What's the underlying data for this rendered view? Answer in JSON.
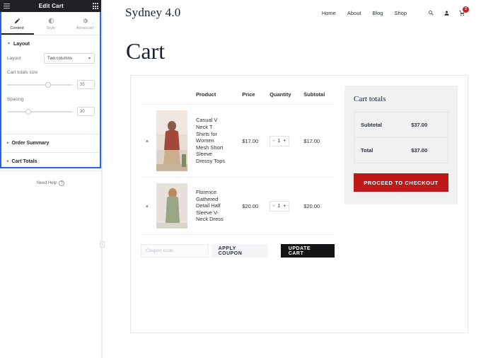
{
  "editor": {
    "topbar": {
      "title": "Edit Cart",
      "menu_icon": "hamburger-icon",
      "apps_icon": "grid-apps-icon"
    },
    "tabs": [
      {
        "label": "Content",
        "icon": "pencil-icon",
        "active": true
      },
      {
        "label": "Style",
        "icon": "contrast-icon",
        "active": false
      },
      {
        "label": "Advanced",
        "icon": "gear-icon",
        "active": false
      }
    ],
    "sections": {
      "layout": {
        "title": "Layout",
        "layout_label": "Layout",
        "layout_value": "Two columns",
        "cart_totals_size_label": "Cart totals size",
        "cart_totals_size_value": "35",
        "spacing_label": "Spacing",
        "spacing_value": "30"
      },
      "order_summary": {
        "title": "Order Summary"
      },
      "cart_totals": {
        "title": "Cart Totals"
      }
    },
    "need_help": {
      "label": "Need Help",
      "icon": "question-circle-icon"
    },
    "collapse_icon": "chevron-left-icon"
  },
  "site": {
    "logo": "Sydney 4.0",
    "nav": [
      {
        "label": "Home"
      },
      {
        "label": "About"
      },
      {
        "label": "Blog"
      },
      {
        "label": "Shop"
      }
    ],
    "icons": {
      "search": "search-icon",
      "account": "user-icon",
      "cart": "cart-icon",
      "cart_count": "2"
    },
    "page_title": "Cart",
    "table": {
      "headers": [
        "",
        "",
        "Product",
        "Price",
        "Quantity",
        "Subtotal"
      ],
      "rows": [
        {
          "remove": "×",
          "name": "Casual V Neck T Shirts for Women Mesh Short Sleeve Dressy Tops",
          "price": "$17.00",
          "qty_minus": "-",
          "qty": "1",
          "qty_plus": "+",
          "subtotal": "$17.00"
        },
        {
          "remove": "×",
          "name": "Florence Gathered Detail Half Sleeve V-Neck Dress",
          "price": "$20.00",
          "qty_minus": "-",
          "qty": "1",
          "qty_plus": "+",
          "subtotal": "$20.00"
        }
      ]
    },
    "coupon": {
      "placeholder": "Coupon code",
      "value": "",
      "apply_label": "APPLY COUPON",
      "update_label": "UPDATE CART"
    },
    "totals": {
      "title": "Cart totals",
      "subtotal_label": "Subtotal",
      "subtotal_value": "$37.00",
      "total_label": "Total",
      "total_value": "$37.00",
      "checkout_label": "PROCEED TO CHECKOUT"
    }
  },
  "colors": {
    "editor_topbar": "#1f2124",
    "panel_outline": "#2563eb",
    "checkout_red": "#c01818",
    "badge_red": "#c81d25",
    "update_black": "#131316",
    "heading_navy": "#1b2033",
    "frame_border": "#efe4ec"
  }
}
